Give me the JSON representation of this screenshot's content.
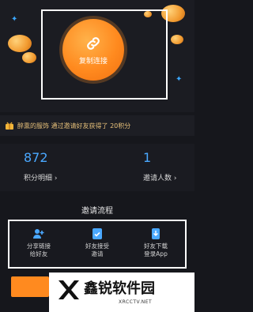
{
  "hero": {
    "copy_button_label": "复制连接",
    "colors": {
      "accent": "#ff8a1f",
      "blue": "#4aa8ff"
    }
  },
  "banner": {
    "text": "醉熏的服饰 通过邀请好友获得了 20积分"
  },
  "stats": {
    "points": {
      "value": "872",
      "label": "积分明细 ›"
    },
    "invites": {
      "value": "1",
      "label": "邀请人数 ›"
    }
  },
  "flow": {
    "title": "邀请流程",
    "steps": [
      {
        "line1": "分享链接",
        "line2": "给好友",
        "icon": "user-add-icon"
      },
      {
        "line1": "好友接受",
        "line2": "邀请",
        "icon": "check-doc-icon"
      },
      {
        "line1": "好友下载",
        "line2": "登录App",
        "icon": "app-download-icon"
      }
    ]
  },
  "watermark": {
    "name": "鑫锐软件园",
    "url": "XRCCTV.NET"
  }
}
